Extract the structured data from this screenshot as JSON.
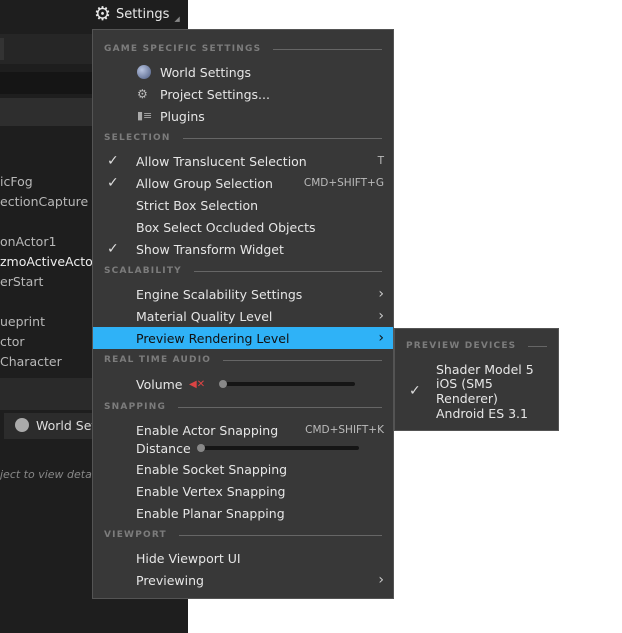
{
  "toolbar": {
    "settings_label": "Settings"
  },
  "outliner": {
    "items": [
      "icFog",
      "ectionCapture",
      "onActor1",
      "zmoActiveActo",
      "erStart",
      "ueprint",
      "ctor",
      "Character"
    ]
  },
  "details": {
    "tab_label": "World Set",
    "hint": "ject to view details"
  },
  "menu": {
    "sections": {
      "game": "GAME SPECIFIC SETTINGS",
      "selection": "SELECTION",
      "scalability": "SCALABILITY",
      "audio": "REAL TIME AUDIO",
      "snapping": "SNAPPING",
      "viewport": "VIEWPORT"
    },
    "game_items": [
      {
        "label": "World Settings",
        "icon": "globe-icon"
      },
      {
        "label": "Project Settings...",
        "icon": "project-settings-icon"
      },
      {
        "label": "Plugins",
        "icon": "plug-icon"
      }
    ],
    "selection_items": [
      {
        "label": "Allow Translucent Selection",
        "checked": true,
        "shortcut": "T"
      },
      {
        "label": "Allow Group Selection",
        "checked": true,
        "shortcut": "CMD+SHIFT+G"
      },
      {
        "label": "Strict Box Selection",
        "checked": false,
        "shortcut": ""
      },
      {
        "label": "Box Select Occluded Objects",
        "checked": false,
        "shortcut": ""
      },
      {
        "label": "Show Transform Widget",
        "checked": true,
        "shortcut": ""
      }
    ],
    "scalability_items": [
      {
        "label": "Engine Scalability Settings"
      },
      {
        "label": "Material Quality Level"
      },
      {
        "label": "Preview Rendering Level",
        "highlighted": true
      }
    ],
    "volume": {
      "label": "Volume",
      "value": 0,
      "muted": true
    },
    "snapping": {
      "actor_label": "Enable Actor Snapping",
      "actor_shortcut": "CMD+SHIFT+K",
      "distance_label": "Distance",
      "distance_value": 0,
      "socket": "Enable Socket Snapping",
      "vertex": "Enable Vertex Snapping",
      "planar": "Enable Planar Snapping"
    },
    "viewport_items": [
      {
        "label": "Hide Viewport UI"
      },
      {
        "label": "Previewing"
      }
    ]
  },
  "submenu": {
    "section": "PREVIEW DEVICES",
    "items": [
      {
        "label": "Shader Model 5",
        "checked": false
      },
      {
        "label": "iOS (SM5 Renderer)",
        "checked": true
      },
      {
        "label": "Android ES 3.1",
        "checked": false
      }
    ]
  },
  "colors": {
    "highlight": "#2fb2f7",
    "menu_bg": "#383838"
  }
}
